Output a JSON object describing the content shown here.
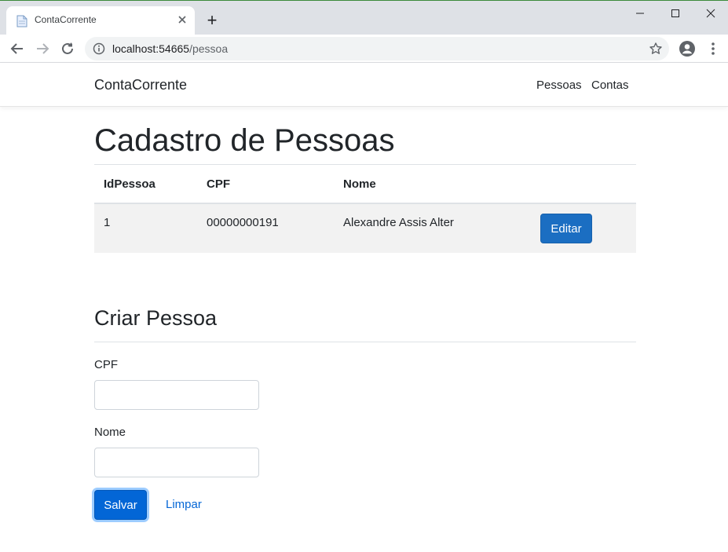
{
  "browser": {
    "tab_title": "ContaCorrente",
    "new_tab_symbol": "+",
    "url_host": "localhost:54665",
    "url_path": "/pessoa"
  },
  "navbar": {
    "brand": "ContaCorrente",
    "links": [
      "Pessoas",
      "Contas"
    ]
  },
  "page": {
    "title": "Cadastro de Pessoas",
    "table": {
      "headers": [
        "IdPessoa",
        "CPF",
        "Nome"
      ],
      "rows": [
        {
          "id": "1",
          "cpf": "00000000191",
          "nome": "Alexandre Assis Alter",
          "action": "Editar"
        }
      ]
    },
    "form": {
      "title": "Criar Pessoa",
      "cpf_label": "CPF",
      "cpf_value": "",
      "nome_label": "Nome",
      "nome_value": "",
      "save_label": "Salvar",
      "clear_label": "Limpar"
    }
  },
  "colors": {
    "primary": "#0366d6",
    "edit_button": "#1b6ec2",
    "row_stripe": "#f2f2f2",
    "tab_strip": "#dee1e6"
  }
}
